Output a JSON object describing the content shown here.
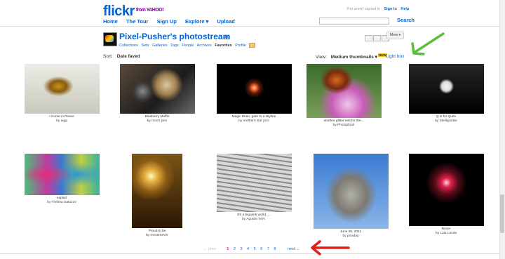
{
  "header": {
    "brand_main": "flickr",
    "brand_tail": "r",
    "brand_sub": "from YAHOO!",
    "nav": [
      "Home",
      "The Tour",
      "Sign Up",
      "Explore ▾",
      "Upload"
    ],
    "not_signed_in": "You aren't signed in",
    "sign_in": "Sign In",
    "help": "Help",
    "search_label": "Search"
  },
  "profile": {
    "title": "Pixel-Pusher's photostream",
    "pro_badge": "pro",
    "subnav": [
      "Collections",
      "Sets",
      "Galleries",
      "Tags",
      "People",
      "Archives"
    ],
    "subnav_current": "Favorites",
    "subnav_profile": "Profile",
    "more_label": "More ▾"
  },
  "toolbar": {
    "sort_label": "Sort:",
    "sort_value": "Date faved",
    "view_label": "View:",
    "view_value": "Medium thumbnails ▾",
    "new_badge": "NEW",
    "lightbox_label": "Light box"
  },
  "photos": [
    {
      "title": "I Come in Peace",
      "by": "by aigg"
    },
    {
      "title": "Blueberry Muffin",
      "by": "by mox's pics"
    },
    {
      "title": "Magic Bean, gate to a skyline",
      "by": "by northern star pics"
    },
    {
      "title": "another glitter test for the...",
      "by": "by Photophool"
    },
    {
      "title": "Q is for Quire",
      "by": "by Skellyjunkie"
    },
    {
      "title": "explod",
      "by": "by Thelma Gatuzzo"
    },
    {
      "title": "Proud to be",
      "by": "by mestertever"
    },
    {
      "title": "It's a big pink world ....",
      "by": "by Agustin W.R."
    },
    {
      "title": "June 26, 2011",
      "by": "by picaday"
    },
    {
      "title": "Rever",
      "by": "by Lola Landa"
    }
  ],
  "pagination": {
    "prev": "← prev",
    "pages": [
      "1",
      "2",
      "3",
      "4",
      "5",
      "6",
      "7",
      "8"
    ],
    "current": "1",
    "next": "next →"
  },
  "colors": {
    "flickr_blue": "#0063dc",
    "flickr_pink": "#ff0084",
    "arrow_green": "#5bbf3a",
    "arrow_red": "#e0201b"
  }
}
